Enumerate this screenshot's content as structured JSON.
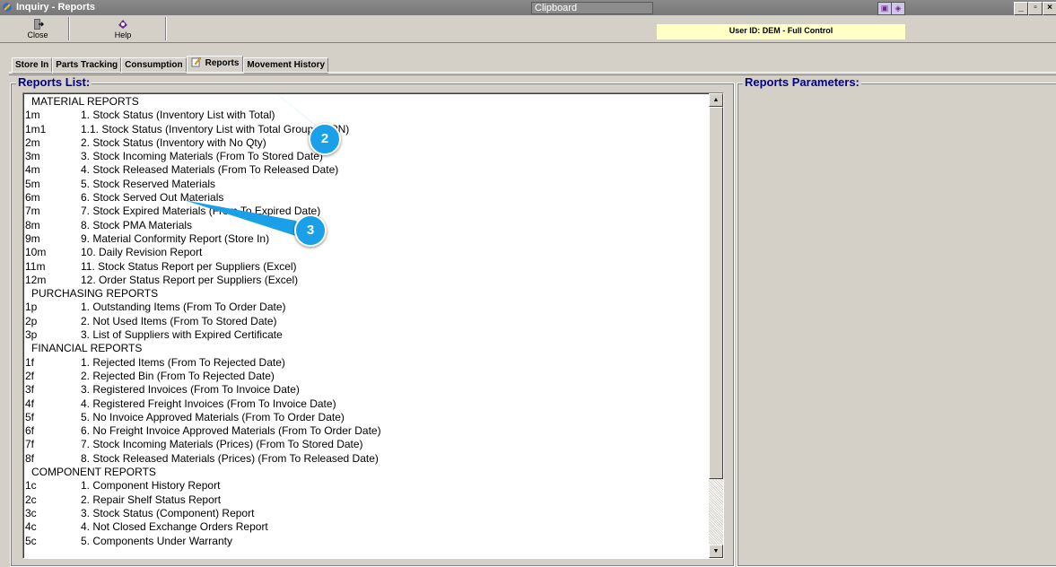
{
  "window": {
    "title": "Inquiry - Reports",
    "clipboard_label": "Clipboard"
  },
  "toolbar": {
    "close_label": "Close",
    "help_label": "Help"
  },
  "user_info": "User ID: DEM - Full Control",
  "tabs": [
    {
      "label": "Store In",
      "active": false
    },
    {
      "label": "Parts Tracking",
      "active": false
    },
    {
      "label": "Consumption",
      "active": false
    },
    {
      "label": "Reports",
      "active": true
    },
    {
      "label": "Movement History",
      "active": false
    }
  ],
  "reports_list": {
    "label": "Reports List:",
    "items": [
      {
        "code": "",
        "text": "MATERIAL REPORTS",
        "header": true
      },
      {
        "code": "1m",
        "text": "1. Stock Status (Inventory List with Total)"
      },
      {
        "code": "1m1",
        "text": "1.1. Stock Status (Inventory List with Total Group by PN)"
      },
      {
        "code": "2m",
        "text": "2. Stock Status (Inventory with No Qty)"
      },
      {
        "code": "3m",
        "text": "3. Stock Incoming Materials (From To Stored Date)"
      },
      {
        "code": "4m",
        "text": "4. Stock Released Materials (From To Released Date)"
      },
      {
        "code": "5m",
        "text": "5. Stock Reserved Materials"
      },
      {
        "code": "6m",
        "text": "6. Stock Served Out Materials"
      },
      {
        "code": "7m",
        "text": "7. Stock Expired Materials (From To Expired Date)"
      },
      {
        "code": "8m",
        "text": "8. Stock PMA Materials"
      },
      {
        "code": "9m",
        "text": "9. Material Conformity Report (Store In)"
      },
      {
        "code": "10m",
        "text": "10. Daily Revision Report"
      },
      {
        "code": "11m",
        "text": "11. Stock Status Report per Suppliers (Excel)"
      },
      {
        "code": "12m",
        "text": "12. Order Status Report per Suppliers (Excel)"
      },
      {
        "code": "",
        "text": "PURCHASING REPORTS",
        "header": true
      },
      {
        "code": "1p",
        "text": "1. Outstanding Items (From To Order Date)"
      },
      {
        "code": "2p",
        "text": "2. Not Used Items (From To Stored Date)"
      },
      {
        "code": "3p",
        "text": "3. List of Suppliers with Expired Certificate"
      },
      {
        "code": "",
        "text": "FINANCIAL REPORTS",
        "header": true
      },
      {
        "code": "1f",
        "text": "1. Rejected Items (From To Rejected Date)"
      },
      {
        "code": "2f",
        "text": "2. Rejected Bin (From To Rejected Date)"
      },
      {
        "code": "3f",
        "text": "3. Registered Invoices (From To Invoice Date)"
      },
      {
        "code": "4f",
        "text": "4. Registered Freight Invoices (From To Invoice Date)"
      },
      {
        "code": "5f",
        "text": "5. No Invoice Approved Materials (From To Order Date)"
      },
      {
        "code": "6f",
        "text": "6. No Freight Invoice Approved Materials (From To Order Date)"
      },
      {
        "code": "7f",
        "text": "7. Stock Incoming Materials (Prices) (From To Stored Date)"
      },
      {
        "code": "8f",
        "text": "8. Stock Released Materials (Prices) (From To Released Date)"
      },
      {
        "code": "",
        "text": "COMPONENT REPORTS",
        "header": true
      },
      {
        "code": "1c",
        "text": "1. Component History Report"
      },
      {
        "code": "2c",
        "text": "2. Repair Shelf Status Report"
      },
      {
        "code": "3c",
        "text": "3. Stock Status (Component) Report"
      },
      {
        "code": "4c",
        "text": "4. Not Closed Exchange Orders Report"
      },
      {
        "code": "5c",
        "text": "5. Components Under Warranty"
      }
    ]
  },
  "reports_parameters": {
    "label": "Reports Parameters:"
  },
  "callouts": [
    "2",
    "3"
  ],
  "colors": {
    "callout": "#1aa0e8",
    "group_label": "#00008b",
    "user_bar": "#ffffc6"
  }
}
